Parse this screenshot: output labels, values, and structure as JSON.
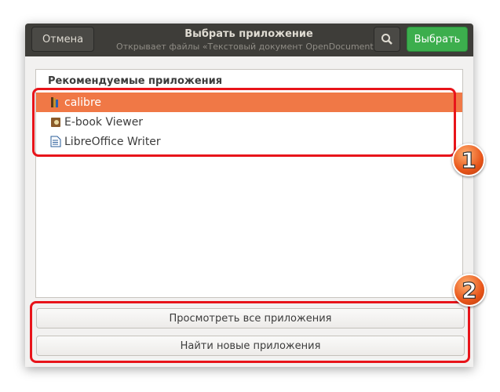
{
  "header": {
    "cancel_label": "Отмена",
    "title": "Выбрать приложение",
    "subtitle": "Открывает файлы «Текстовый документ OpenDocument».",
    "select_label": "Выбрать"
  },
  "list": {
    "section_title": "Рекомендуемые приложения",
    "apps": [
      {
        "name": "calibre",
        "selected": true
      },
      {
        "name": "E-book Viewer",
        "selected": false
      },
      {
        "name": "LibreOffice Writer",
        "selected": false
      }
    ]
  },
  "footer": {
    "view_all_label": "Просмотреть все приложения",
    "find_new_label": "Найти новые приложения"
  },
  "annotations": {
    "badge1": "1",
    "badge2": "2"
  },
  "colors": {
    "selection": "#f07846",
    "accent_button": "#3cae4d",
    "highlight": "#e8141a"
  }
}
